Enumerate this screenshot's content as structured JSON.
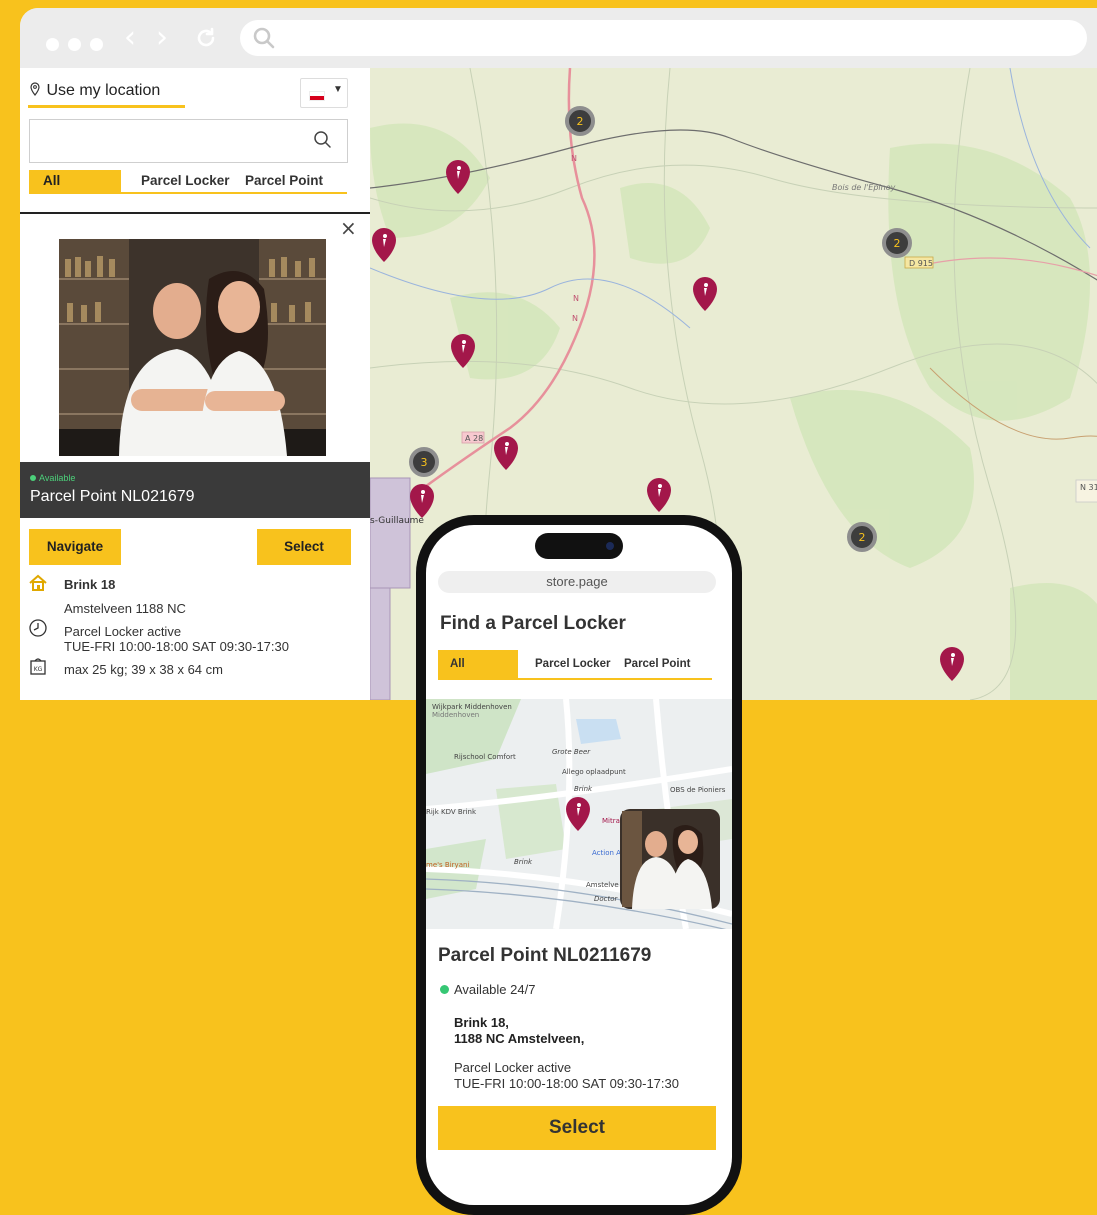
{
  "desktop": {
    "use_location": "Use my location",
    "search_placeholder": "",
    "tabs": [
      "All",
      "Parcel Locker",
      "Parcel Point"
    ],
    "close": "×",
    "status": "Available",
    "title": "Parcel Point NL021679",
    "navigate": "Navigate",
    "select": "Select",
    "street": "Brink 18",
    "city": "Amstelveen 1188 NC",
    "locker_status": "Parcel Locker active",
    "hours": "TUE-FRI 10:00-18:00 SAT 09:30-17:30",
    "dimensions": "max 25 kg; 39 x 38 x 64 cm"
  },
  "map": {
    "clusters": [
      "2",
      "2",
      "3",
      "2"
    ],
    "roads": [
      "D 915",
      "A 28",
      "N 31",
      "N",
      "N",
      "N"
    ],
    "places": [
      "Bois de l'Épinoy",
      "s-Guillaume"
    ]
  },
  "mobile": {
    "url": "store.page",
    "heading": "Find a Parcel Locker",
    "tabs": [
      "All",
      "Parcel Locker",
      "Parcel Point"
    ],
    "map_labels": [
      "Wijkpark Middenhoven",
      "Rijschool Comfort",
      "Grote Beer",
      "Allego oplaadpunt",
      "Brink",
      "OBS de Pioniers",
      "Rijk KDV Brink",
      "Mitra Am",
      "Action A",
      "me's Biryani",
      "Brink",
      "Amstelve",
      "Doctor"
    ],
    "title": "Parcel Point NL0211679",
    "availability": "Available 24/7",
    "address_line1": "Brink 18,",
    "address_line2": "1188 NC Amstelveen,",
    "locker_status": "Parcel Locker active",
    "hours": "TUE-FRI 10:00-18:00 SAT 09:30-17:30",
    "select": "Select"
  },
  "colors": {
    "accent": "#f8c21d",
    "pin": "#a3174a",
    "panel_dark": "#3a3a3a",
    "available": "#36c774"
  },
  "icons": [
    "search-icon",
    "location-pin-icon",
    "close-icon",
    "house-icon",
    "clock-icon",
    "weight-icon",
    "back-icon",
    "forward-icon",
    "reload-icon",
    "parcel-pin-icon"
  ]
}
